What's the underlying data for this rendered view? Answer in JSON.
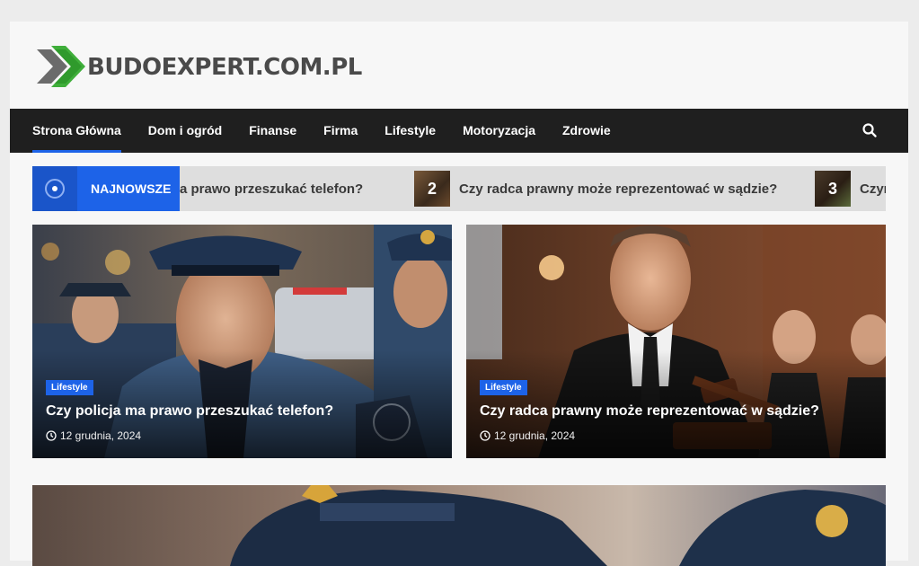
{
  "site": {
    "logo_text": "BUDOEXPERT.COM.PL",
    "logo_icon": "double-chevron-logo-icon"
  },
  "nav": {
    "items": [
      {
        "label": "Strona Główna",
        "active": true
      },
      {
        "label": "Dom i ogród"
      },
      {
        "label": "Finanse"
      },
      {
        "label": "Firma"
      },
      {
        "label": "Lifestyle"
      },
      {
        "label": "Motoryzacja"
      },
      {
        "label": "Zdrowie"
      }
    ],
    "search_icon": "search-icon"
  },
  "ticker": {
    "label": "NAJNOWSZE",
    "icon": "radio-dot-icon",
    "items": [
      {
        "title": "a prawo przeszukać telefon?"
      },
      {
        "number": "2",
        "title": "Czy radca prawny może reprezentować w sądzie?"
      },
      {
        "number": "3",
        "title": "Czyr"
      }
    ]
  },
  "featured": [
    {
      "category": "Lifestyle",
      "title": "Czy policja ma prawo przeszukać telefon?",
      "date": "12 grudnia, 2024"
    },
    {
      "category": "Lifestyle",
      "title": "Czy radca prawny może reprezentować w sądzie?",
      "date": "12 grudnia, 2024"
    }
  ],
  "colors": {
    "accent": "#1d63e8",
    "navbar": "#1f1f1f",
    "page_bg": "#ececec"
  }
}
